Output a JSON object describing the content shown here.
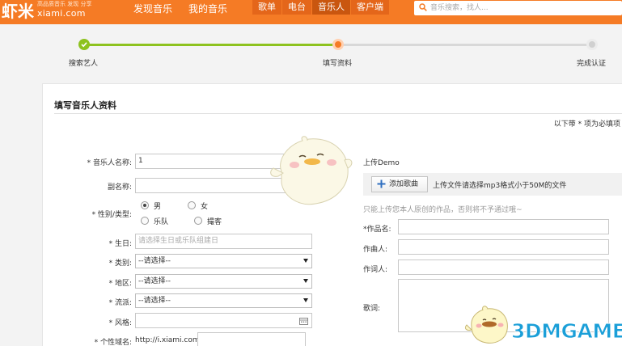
{
  "header": {
    "logo_main": "虾米",
    "logo_sub": "高品质音乐 发现 分享",
    "logo_domain": "xiami.com",
    "nav_main": [
      "发现音乐",
      "我的音乐"
    ],
    "nav_tabs": [
      {
        "label": "歌单",
        "active": false
      },
      {
        "label": "电台",
        "active": false
      },
      {
        "label": "音乐人",
        "active": true
      },
      {
        "label": "客户端",
        "active": false
      }
    ],
    "search_placeholder": "音乐搜索，找人...",
    "brand_color": "#f57b25"
  },
  "steps": [
    {
      "label": "搜索艺人",
      "state": "done"
    },
    {
      "label": "填写资料",
      "state": "current"
    },
    {
      "label": "完成认证",
      "state": "todo"
    }
  ],
  "form": {
    "title": "填写音乐人资料",
    "required_note": "以下带 * 项为必填项",
    "labels": {
      "name": "* 音乐人名称:",
      "alias": "副名称:",
      "gender": "* 性别/类型:",
      "birthday": "* 生日:",
      "category": "* 类别:",
      "region": "* 地区:",
      "genre": "* 流派:",
      "style": "* 风格:",
      "domain": "* 个性域名:"
    },
    "values": {
      "name": "1",
      "alias": "",
      "style": "",
      "domain": ""
    },
    "birthday_placeholder": "请选择生日或乐队组建日",
    "gender_options": [
      {
        "label": "男",
        "checked": true
      },
      {
        "label": "女",
        "checked": false
      },
      {
        "label": "乐队",
        "checked": false
      },
      {
        "label": "撮客",
        "checked": false
      }
    ],
    "select_default": "--请选择--",
    "domain_prefix": "http://i.xiami.com/"
  },
  "upload": {
    "title": "上传Demo",
    "add_button": "添加歌曲",
    "hint": "上传文件请选择mp3格式小于50M的文件",
    "warning": "只能上传您本人原创的作品，否则将不予通过哦~",
    "labels": {
      "work": "*作品名:",
      "composer": "作曲人:",
      "lyricist": "作词人:",
      "lyrics": "歌词:"
    },
    "values": {
      "work": "",
      "composer": "",
      "lyricist": "",
      "lyrics": ""
    }
  },
  "watermark": "3DMGAME"
}
